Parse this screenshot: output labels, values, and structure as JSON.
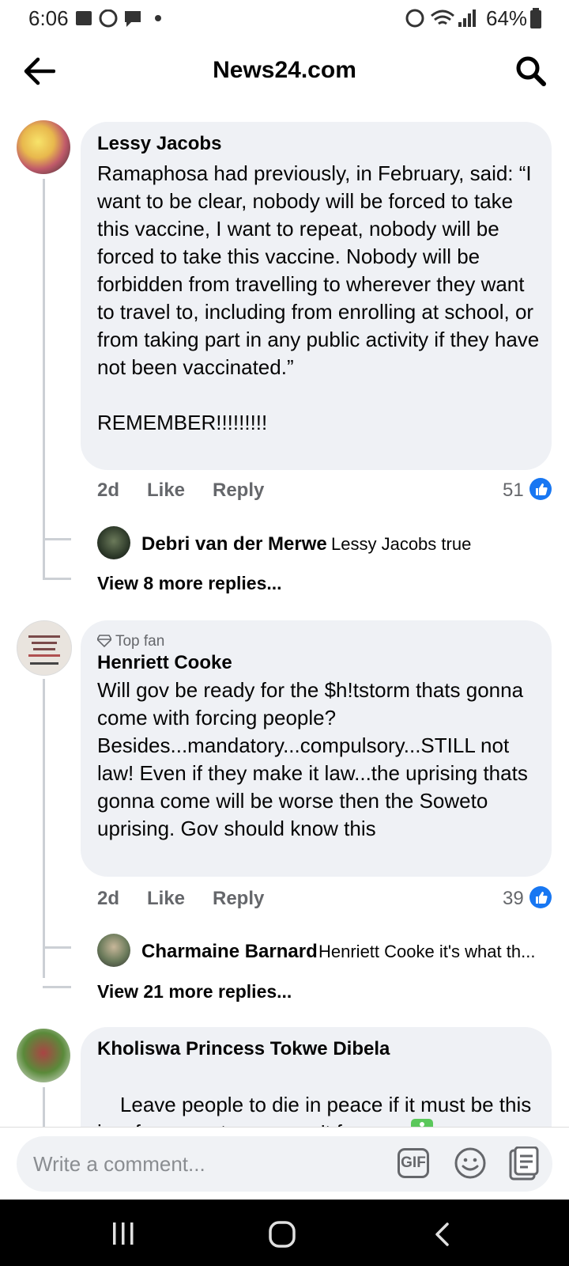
{
  "status_bar": {
    "time": "6:06",
    "battery": "64%"
  },
  "header": {
    "title": "News24.com",
    "back_icon": "arrow-left-icon",
    "search_icon": "search-icon"
  },
  "comments": [
    {
      "author": "Lessy Jacobs",
      "text": "Ramaphosa had previously, in February, said: “I want to be clear, nobody will be forced to take this vaccine, I want to repeat, nobody will be forced to take this vaccine. Nobody will be forbidden from travelling to wherever they want to travel to, including from enrolling at school, or from taking part in any public activity if they have not been vaccinated.”\n\nREMEMBER!!!!!!!!!",
      "time": "2d",
      "like": "Like",
      "reply": "Reply",
      "reactions": "51",
      "reply_preview": {
        "author": "Debri van der Merwe",
        "text": "Lessy Jacobs true"
      },
      "more_replies": "View 8 more replies..."
    },
    {
      "badge": "Top fan",
      "author": "Henriett Cooke",
      "text": "Will gov be ready for the $h!tstorm thats gonna come with forcing people? Besides...mandatory...compulsory...STILL not law! Even if they make it law...the uprising thats gonna come will be worse then the Soweto uprising. Gov should know this",
      "time": "2d",
      "like": "Like",
      "reply": "Reply",
      "reactions": "39",
      "reply_preview": {
        "author": "Charmaine Barnard",
        "text": "Henriett Cooke it's what th..."
      },
      "more_replies": "View 21 more replies..."
    },
    {
      "author": "Kholiswa Princess Tokwe Dibela",
      "text": "Leave people to die in peace if it must be this is a free country you can't force us"
    }
  ],
  "composer": {
    "placeholder": "Write a comment...",
    "gif_label": "GIF"
  },
  "colors": {
    "bubble": "#eff1f5",
    "like_blue": "#1877f2",
    "meta_gray": "#65676b"
  }
}
